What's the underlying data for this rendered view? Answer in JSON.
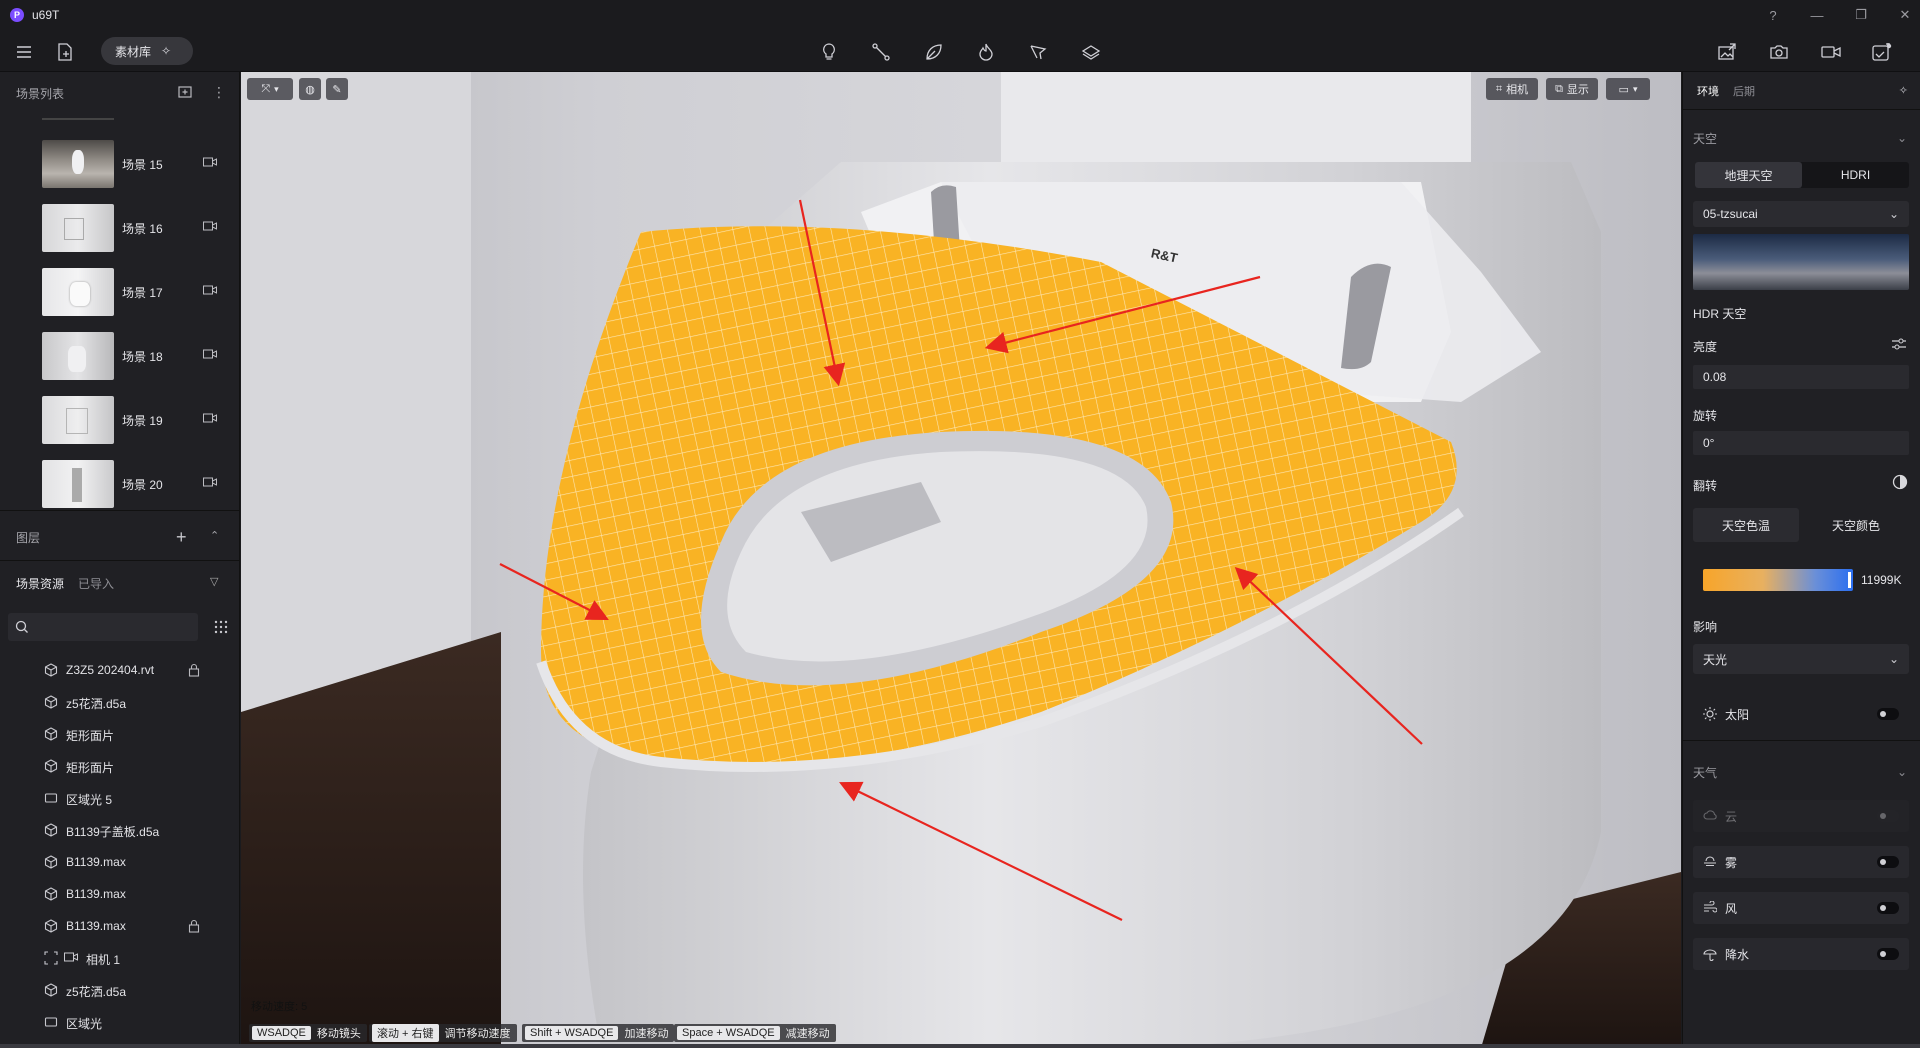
{
  "app": {
    "title": "u69T",
    "logo_letter": "P"
  },
  "window_controls": [
    "?",
    "—",
    "❐",
    "✕"
  ],
  "toolbar": {
    "asset_library_label": "素材库",
    "center_icons": [
      "lightbulb-icon",
      "path-icon",
      "leaf-icon",
      "flame-icon",
      "tree-icon",
      "layers-icon"
    ],
    "right_icons": [
      "export-image-icon",
      "camera-icon",
      "video-icon",
      "render-icon"
    ]
  },
  "left_panel": {
    "scene_list_title": "场景列表",
    "scenes": [
      {
        "label": "场景 15"
      },
      {
        "label": "场景 16"
      },
      {
        "label": "场景 17"
      },
      {
        "label": "场景 18"
      },
      {
        "label": "场景 19"
      },
      {
        "label": "场景 20"
      }
    ],
    "layers_title": "图层",
    "tabs": {
      "active": "场景资源",
      "inactive": "已导入"
    },
    "resources": [
      {
        "label": "Z3Z5 202404.rvt",
        "icon": "cube-icon",
        "locked": true
      },
      {
        "label": "z5花洒.d5a",
        "icon": "cube-icon",
        "locked": false
      },
      {
        "label": "矩形面片",
        "icon": "cube-icon",
        "locked": false
      },
      {
        "label": "矩形面片",
        "icon": "cube-icon",
        "locked": false
      },
      {
        "label": "区域光 5",
        "icon": "area-light-icon",
        "locked": false
      },
      {
        "label": "B1139子盖板.d5a",
        "icon": "cube-icon",
        "locked": false
      },
      {
        "label": "B1139.max",
        "icon": "cube-icon",
        "locked": false
      },
      {
        "label": "B1139.max",
        "icon": "cube-icon",
        "locked": false
      },
      {
        "label": "B1139.max",
        "icon": "cube-icon",
        "locked": true
      },
      {
        "label": "相机 1",
        "icon": "camera-icon",
        "locked": false
      },
      {
        "label": "z5花洒.d5a",
        "icon": "cube-icon",
        "locked": false
      },
      {
        "label": "区域光",
        "icon": "area-light-icon",
        "locked": false
      }
    ]
  },
  "viewport": {
    "camera_btn": "相机",
    "display_btn": "显示",
    "brand_text": "R&T",
    "move_speed_label": "移动速度: 5",
    "hints": [
      {
        "key": "WSADQE",
        "text": "移动镜头"
      },
      {
        "key": "滚动 + 右键",
        "text": "调节移动速度"
      },
      {
        "key": "Shift + WSADQE",
        "text": "加速移动"
      },
      {
        "key": "Space + WSADQE",
        "text": "减速移动"
      }
    ],
    "colors": {
      "seat_tile": "#f9b324",
      "arrow": "#e8251f"
    }
  },
  "right_panel": {
    "tabs": {
      "active": "环境",
      "inactive": "后期"
    },
    "sky_section": "天空",
    "sky_modes": {
      "geo": "地理天空",
      "hdri": "HDRI"
    },
    "hdri_select": "05-tzsucai",
    "hdr_sky_label": "HDR 天空",
    "brightness_label": "亮度",
    "brightness_value": "0.08",
    "rotation_label": "旋转",
    "rotation_value": "0°",
    "flip_label": "翻转",
    "sky_temp_btn": "天空色温",
    "sky_color_btn": "天空颜色",
    "temperature_value": "11999K",
    "influence_label": "影响",
    "influence_value": "天光",
    "sun_label": "太阳",
    "weather_section": "天气",
    "weather_items": [
      {
        "label": "云",
        "icon": "cloud-icon",
        "disabled": true
      },
      {
        "label": "雾",
        "icon": "fog-icon",
        "disabled": false
      },
      {
        "label": "风",
        "icon": "wind-icon",
        "disabled": false
      },
      {
        "label": "降水",
        "icon": "rain-icon",
        "disabled": false
      }
    ]
  }
}
